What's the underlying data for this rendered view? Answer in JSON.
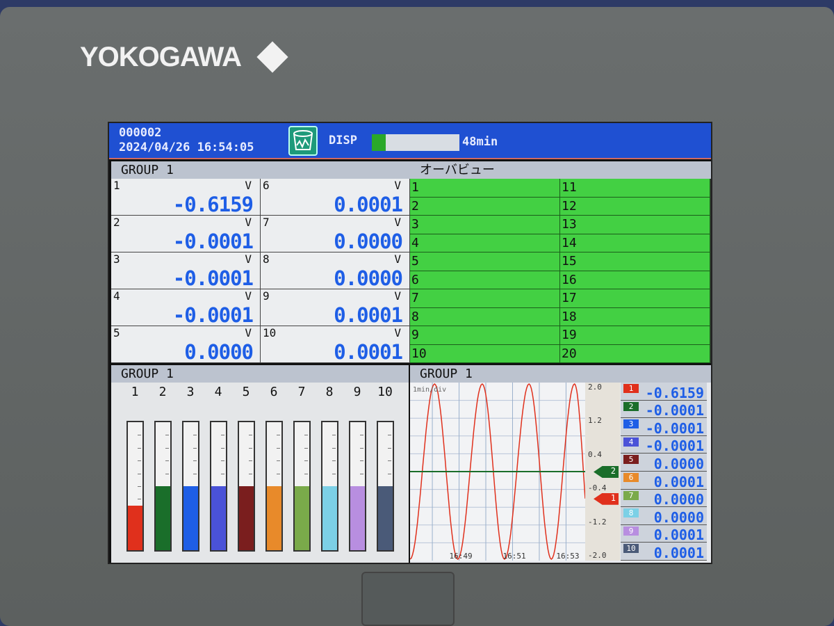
{
  "device": {
    "brand": "YOKOGAWA"
  },
  "header": {
    "batch_number": "000002",
    "datetime": "2024/04/26 16:54:05",
    "status_icon": "memory-sampling-icon",
    "mode_label": "DISP",
    "memory_progress_percent": 8,
    "memory_remaining": "48min"
  },
  "digital_panel": {
    "title": "GROUP 1",
    "channels": [
      {
        "ch": "1",
        "unit": "V",
        "value": "-0.6159"
      },
      {
        "ch": "2",
        "unit": "V",
        "value": "-0.0001"
      },
      {
        "ch": "3",
        "unit": "V",
        "value": "-0.0001"
      },
      {
        "ch": "4",
        "unit": "V",
        "value": "-0.0001"
      },
      {
        "ch": "5",
        "unit": "V",
        "value": "0.0000"
      },
      {
        "ch": "6",
        "unit": "V",
        "value": "0.0001"
      },
      {
        "ch": "7",
        "unit": "V",
        "value": "0.0000"
      },
      {
        "ch": "8",
        "unit": "V",
        "value": "0.0000"
      },
      {
        "ch": "9",
        "unit": "V",
        "value": "0.0001"
      },
      {
        "ch": "10",
        "unit": "V",
        "value": "0.0001"
      }
    ]
  },
  "overview_panel": {
    "title": "オーバビュー",
    "items": [
      "1",
      "2",
      "3",
      "4",
      "5",
      "6",
      "7",
      "8",
      "9",
      "10",
      "11",
      "12",
      "13",
      "14",
      "15",
      "16",
      "17",
      "18",
      "19",
      "20"
    ],
    "status_color": "#43d043"
  },
  "bar_panel": {
    "title": "GROUP 1",
    "labels": [
      "1",
      "2",
      "3",
      "4",
      "5",
      "6",
      "7",
      "8",
      "9",
      "10"
    ],
    "range": [
      -2.0,
      2.0
    ],
    "values": [
      -0.6159,
      -0.0001,
      -0.0001,
      -0.0001,
      0.0,
      0.0001,
      0.0,
      0.0,
      0.0001,
      0.0001
    ]
  },
  "channel_colors": [
    "#e0301c",
    "#1a6e2a",
    "#1e5ee6",
    "#4a52d8",
    "#7a1e1e",
    "#e88a2a",
    "#7aaa4a",
    "#7cd0e6",
    "#b88ee0",
    "#4a5a78"
  ],
  "trend_panel": {
    "title": "GROUP 1",
    "div_label": "1min/div",
    "values": [
      "-0.6159",
      "-0.0001",
      "-0.0001",
      "-0.0001",
      "0.0000",
      "0.0001",
      "0.0000",
      "0.0000",
      "0.0001",
      "0.0001"
    ]
  },
  "chart_data": {
    "type": "line",
    "ylim": [
      -2.0,
      2.0
    ],
    "y_ticks": [
      "2.0",
      "1.2",
      "0.4",
      "-0.4",
      "-1.2",
      "-2.0"
    ],
    "x_ticks": [
      "16:49",
      "16:51",
      "16:53"
    ],
    "xlim": [
      "16:47:10",
      "16:53:43"
    ],
    "grid": true,
    "series": [
      {
        "channel": "1",
        "x": [
          "16:47:10",
          "16:48:05",
          "16:48:57",
          "16:49:52",
          "16:50:42",
          "16:51:37",
          "16:52:27",
          "16:53:19",
          "16:53:43"
        ],
        "y": [
          -2.0,
          2.0,
          -2.0,
          2.0,
          -2.0,
          2.0,
          -2.0,
          2.0,
          -0.6159
        ]
      },
      {
        "channel": "2",
        "x": [
          "16:47:10",
          "16:53:43"
        ],
        "y": [
          0.0,
          0.0
        ]
      }
    ],
    "markers": [
      "1",
      "2"
    ]
  }
}
